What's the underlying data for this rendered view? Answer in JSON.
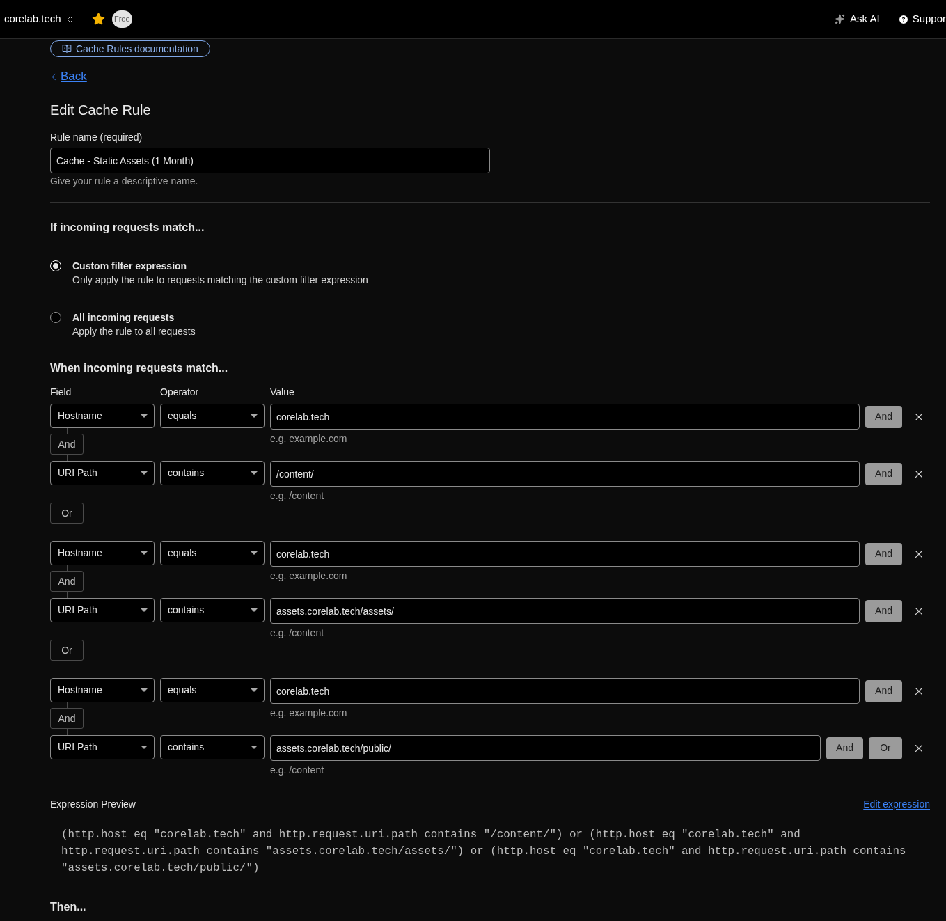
{
  "top_bar": {
    "account": "corelab.tech",
    "badge": "Free",
    "actions": [
      {
        "kind": "ai",
        "label": "Ask AI"
      },
      {
        "kind": "support",
        "label": "Suppor"
      }
    ]
  },
  "docs_link": "Cache Rules documentation",
  "back_link": "Back",
  "title": "Edit Cache Rule",
  "rule_name": {
    "label": "Rule name (required)",
    "value": "Cache - Static Assets (1 Month)",
    "hint": "Give your rule a descriptive name."
  },
  "match_mode": {
    "heading": "If incoming requests match...",
    "options": [
      {
        "title": "Custom filter expression",
        "description": "Only apply the rule to requests matching the custom filter expression",
        "selected": true
      },
      {
        "title": "All incoming requests",
        "description": "Apply the rule to all requests",
        "selected": false
      }
    ]
  },
  "conditions": {
    "heading": "When incoming requests match...",
    "columns": [
      "Field",
      "Operator",
      "Value"
    ],
    "rows": [
      {
        "field": "Hostname",
        "operator": "equals",
        "value": "corelab.tech",
        "hint": "e.g. example.com",
        "buttons": [
          "And"
        ],
        "next": {
          "kind": "and",
          "label": "And"
        }
      },
      {
        "field": "URI Path",
        "operator": "contains",
        "value": "/content/",
        "hint": "e.g. /content",
        "buttons": [
          "And"
        ],
        "next": {
          "kind": "or",
          "label": "Or"
        }
      },
      {
        "field": "Hostname",
        "operator": "equals",
        "value": "corelab.tech",
        "hint": "e.g. example.com",
        "buttons": [
          "And"
        ],
        "next": {
          "kind": "and",
          "label": "And"
        }
      },
      {
        "field": "URI Path",
        "operator": "contains",
        "value": "assets.corelab.tech/assets/",
        "hint": "e.g. /content",
        "buttons": [
          "And"
        ],
        "next": {
          "kind": "or",
          "label": "Or"
        }
      },
      {
        "field": "Hostname",
        "operator": "equals",
        "value": "corelab.tech",
        "hint": "e.g. example.com",
        "buttons": [
          "And"
        ],
        "next": {
          "kind": "and",
          "label": "And"
        }
      },
      {
        "field": "URI Path",
        "operator": "contains",
        "value": "assets.corelab.tech/public/",
        "hint": "e.g. /content",
        "buttons": [
          "And",
          "Or"
        ]
      }
    ]
  },
  "expression_preview": {
    "label": "Expression Preview",
    "link": "Edit expression",
    "code": "(http.host eq \"corelab.tech\" and http.request.uri.path contains \"/content/\") or (http.host eq \"corelab.tech\" and http.request.uri.path contains \"assets.corelab.tech/assets/\") or (http.host eq \"corelab.tech\" and http.request.uri.path contains \"assets.corelab.tech/public/\")"
  },
  "then_heading": "Then..."
}
